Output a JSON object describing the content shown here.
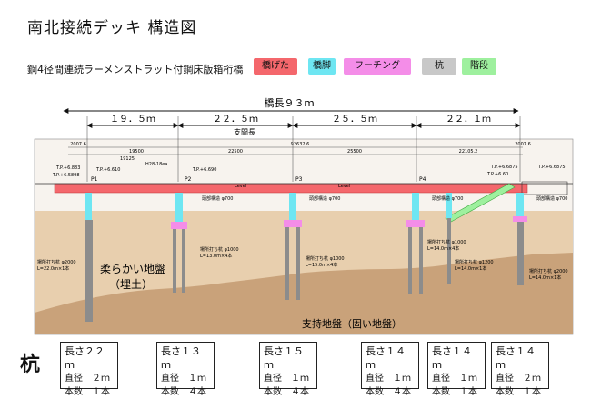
{
  "page": {
    "title": "南北接続デッキ 構造図",
    "subtitle": "鋼4径間連続ラーメンストラット付鋼床版箱桁橋"
  },
  "legend": [
    {
      "label": "橋げた",
      "color": "#f4676c"
    },
    {
      "label": "橋脚",
      "color": "#6ee6f2"
    },
    {
      "label": "フーチング",
      "color": "#f48de8"
    },
    {
      "label": "杭",
      "color": "#c8c8c8"
    },
    {
      "label": "階段",
      "color": "#9ef09e"
    }
  ],
  "bridge": {
    "total_length_label": "橋長９３ｍ",
    "span_header": "支間長",
    "spans": [
      "１９．５ｍ",
      "２２．５ｍ",
      "２５．５ｍ",
      "２２．１ｍ"
    ],
    "dims": {
      "total_mm": "92632.6",
      "span1_mm": "19500",
      "span2_mm": "22500",
      "span3_mm": "25500",
      "span4_mm": "22105.2",
      "left_end_mm": "2007.6",
      "left_inner_mm": "19125",
      "right_end_mm": "2007.6"
    },
    "piers": [
      "P1",
      "P2",
      "P3",
      "P4"
    ],
    "soft_ground": "柔らかい地盤",
    "soft_ground_sub": "（埋土）",
    "firm_ground": "支持地盤（固い地盤）",
    "annotations": {
      "tp_left_top": "T.P.+6.883",
      "tp_left_bottom": "T.P.+6.5898",
      "tp_p1": "T.P.+6.610",
      "tp_p2": "T.P.+6.690",
      "tp_p2_note": "H28-18ea",
      "tp_right_a": "T.P.+6.6875",
      "tp_right_b": "T.P.+6.60",
      "tp_right_c": "T.P.+6.6875",
      "level": "Level",
      "bearing": "頭部構造 φ700",
      "pile_left": "場所打ち杭 φ2000",
      "pile_left_len": "L=22.0m×1本",
      "pile_p2": "場所打ち杭 φ1000",
      "pile_p2_len": "L=13.0m×4本",
      "pile_p3": "場所打ち杭 φ1000",
      "pile_p3_len": "L=15.0m×4本",
      "pile_p4": "場所打ち杭 φ1000",
      "pile_p4_len": "L=14.0m×4本",
      "pile_p5": "場所打ち杭 φ1200",
      "pile_p5_len": "L=14.0m×1本",
      "pile_right": "場所打ち杭 φ2000",
      "pile_right_len": "L=14.0m×1本"
    }
  },
  "piles": {
    "heading": "杭",
    "items": [
      {
        "length": "長さ２２ｍ",
        "diameter": "直径　２ｍ",
        "count": "本数　１本"
      },
      {
        "length": "長さ１３ｍ",
        "diameter": "直径　１ｍ",
        "count": "本数　４本"
      },
      {
        "length": "長さ１５ｍ",
        "diameter": "直径　１ｍ",
        "count": "本数　４本"
      },
      {
        "length": "長さ１４ｍ",
        "diameter": "直径　１ｍ",
        "count": "本数　４本"
      },
      {
        "length": "長さ１４ｍ",
        "diameter": "直径　１ｍ",
        "count": "本数　１本"
      },
      {
        "length": "長さ１４ｍ",
        "diameter": "直径　２ｍ",
        "count": "本数　１本"
      }
    ]
  }
}
